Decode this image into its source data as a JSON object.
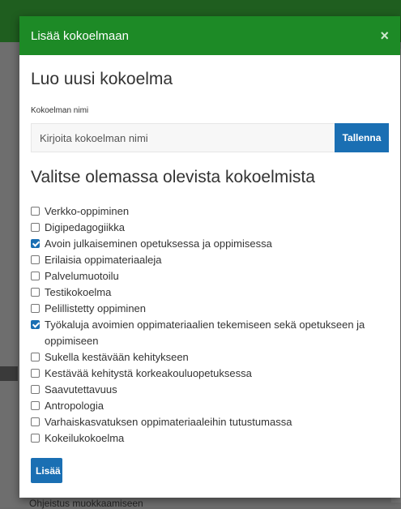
{
  "modal": {
    "title": "Lisää kokoelmaan",
    "close": "×",
    "create_heading": "Luo uusi kokoelma",
    "name_label": "Kokoelman nimi",
    "name_placeholder": "Kirjoita kokoelman nimi",
    "save_label": "Tallenna",
    "select_heading": "Valitse olemassa olevista kokoelmista",
    "collections": [
      {
        "label": "Verkko-oppiminen",
        "checked": false
      },
      {
        "label": "Digipedagogiikka",
        "checked": false
      },
      {
        "label": "Avoin julkaiseminen opetuksessa ja oppimisessa",
        "checked": true
      },
      {
        "label": "Erilaisia oppimateriaaleja",
        "checked": false
      },
      {
        "label": "Palvelumuotoilu",
        "checked": false
      },
      {
        "label": "Testikokoelma",
        "checked": false
      },
      {
        "label": "Pelillistetty oppiminen",
        "checked": false
      },
      {
        "label": "Työkaluja avoimien oppimateriaalien tekemiseen sekä opetukseen ja oppimiseen",
        "checked": true
      },
      {
        "label": "Sukella kestävään kehitykseen",
        "checked": false
      },
      {
        "label": "Kestävää kehitystä korkeakouluopetuksessa",
        "checked": false
      },
      {
        "label": "Saavutettavuus",
        "checked": false
      },
      {
        "label": "Antropologia",
        "checked": false
      },
      {
        "label": "Varhaiskasvatuksen oppimateriaaleihin tutustumassa",
        "checked": false
      },
      {
        "label": "Kokeilukokoelma",
        "checked": false
      }
    ],
    "add_label": "Lisää"
  },
  "background": {
    "bottom_text": "Ohjeistus muokkaamiseen"
  },
  "colors": {
    "header_green": "#1d8a26",
    "primary_blue": "#1a6fb3"
  }
}
